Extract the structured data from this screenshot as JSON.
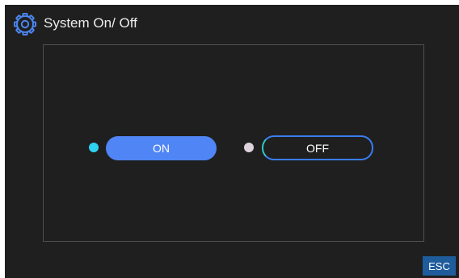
{
  "header": {
    "icon": "gear-icon",
    "title": "System On/ Off"
  },
  "controls": {
    "on": {
      "label": "ON",
      "indicator_color": "#2ed3f1",
      "button_color": "#5085f5"
    },
    "off": {
      "label": "OFF",
      "indicator_color": "#ddd3dc",
      "border_color": "#3a7df0"
    }
  },
  "footer": {
    "esc_label": "ESC",
    "esc_color": "#1f5c9c"
  },
  "colors": {
    "background": "#1f1f1f",
    "accent": "#3a7df0"
  }
}
